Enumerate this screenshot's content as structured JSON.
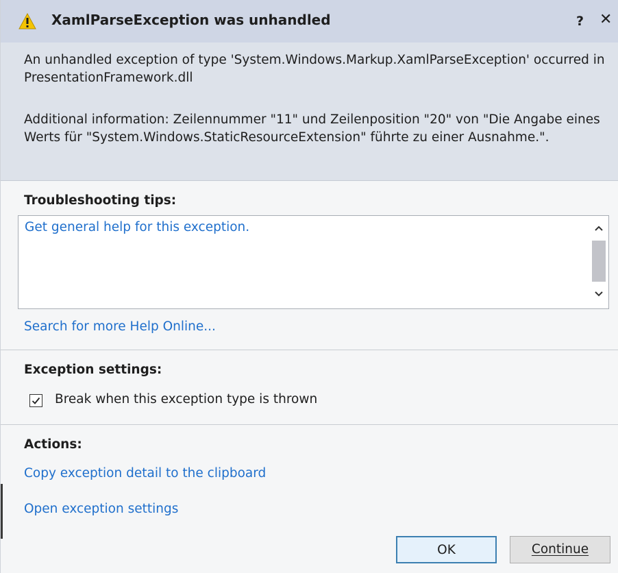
{
  "dialog": {
    "title": "XamlParseException was unhandled",
    "help_glyph": "?",
    "close_glyph": "✕",
    "message_line": "An unhandled exception of type 'System.Windows.Markup.XamlParseException' occurred in PresentationFramework.dll",
    "additional_info": "Additional information: Zeilennummer \"11\" und Zeilenposition \"20\" von \"Die Angabe eines Werts für \"System.Windows.StaticResourceExtension\" führte zu einer Ausnahme.\".",
    "icon": "warning-icon",
    "colors": {
      "title_bg": "#cfd6e5",
      "header_bg": "#dde2ea",
      "body_bg": "#f5f6f7",
      "link": "#1f6fcc",
      "warning": "#f5c400"
    }
  },
  "troubleshooting": {
    "title": "Troubleshooting tips:",
    "tip_link": "Get general help for this exception.",
    "search_link": "Search for more Help Online..."
  },
  "exception_settings": {
    "title": "Exception settings:",
    "break_label": "Break when this exception type is thrown",
    "break_checked": true
  },
  "actions": {
    "title": "Actions:",
    "copy_link": "Copy exception detail to the clipboard",
    "open_settings_link": "Open exception settings"
  },
  "buttons": {
    "ok": "OK",
    "continue": "Continue"
  }
}
